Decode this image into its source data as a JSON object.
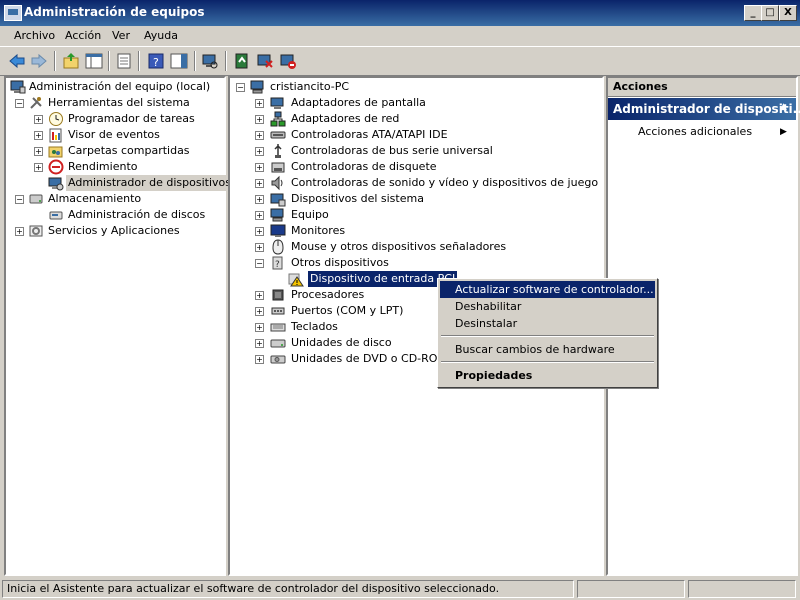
{
  "window": {
    "title": "Administración de equipos",
    "min": "_",
    "max": "□",
    "close": "X"
  },
  "menu": [
    "Archivo",
    "Acción",
    "Ver",
    "Ayuda"
  ],
  "left_tree": {
    "root": "Administración del equipo (local)",
    "herramientas": "Herramientas del sistema",
    "programador": "Programador de tareas",
    "visor": "Visor de eventos",
    "carpetas": "Carpetas compartidas",
    "rendimiento": "Rendimiento",
    "admin_disp": "Administrador de dispositivos",
    "almacenamiento": "Almacenamiento",
    "admin_discos": "Administración de discos",
    "servicios": "Servicios y Aplicaciones"
  },
  "device_tree": {
    "root": "cristiancito-PC",
    "items": [
      "Adaptadores de pantalla",
      "Adaptadores de red",
      "Controladoras ATA/ATAPI IDE",
      "Controladoras de bus serie universal",
      "Controladoras de disquete",
      "Controladoras de sonido y vídeo y dispositivos de juego",
      "Dispositivos del sistema",
      "Equipo",
      "Monitores",
      "Mouse y otros dispositivos señaladores",
      "Otros dispositivos",
      "Dispositivo de entrada PCI",
      "Procesadores",
      "Puertos (COM y LPT)",
      "Teclados",
      "Unidades de disco",
      "Unidades de DVD o CD-ROM"
    ]
  },
  "actions": {
    "header": "Acciones",
    "section": "Administrador de dispositi...",
    "more": "Acciones adicionales"
  },
  "context_menu": {
    "update": "Actualizar software de controlador...",
    "disable": "Deshabilitar",
    "uninstall": "Desinstalar",
    "scan": "Buscar cambios de hardware",
    "properties": "Propiedades"
  },
  "status": {
    "text": "Inicia el Asistente para actualizar el software de controlador del dispositivo seleccionado."
  },
  "colors": {
    "selection": "#0a246a",
    "face": "#d4d0c8",
    "warning": "#f5c400"
  }
}
